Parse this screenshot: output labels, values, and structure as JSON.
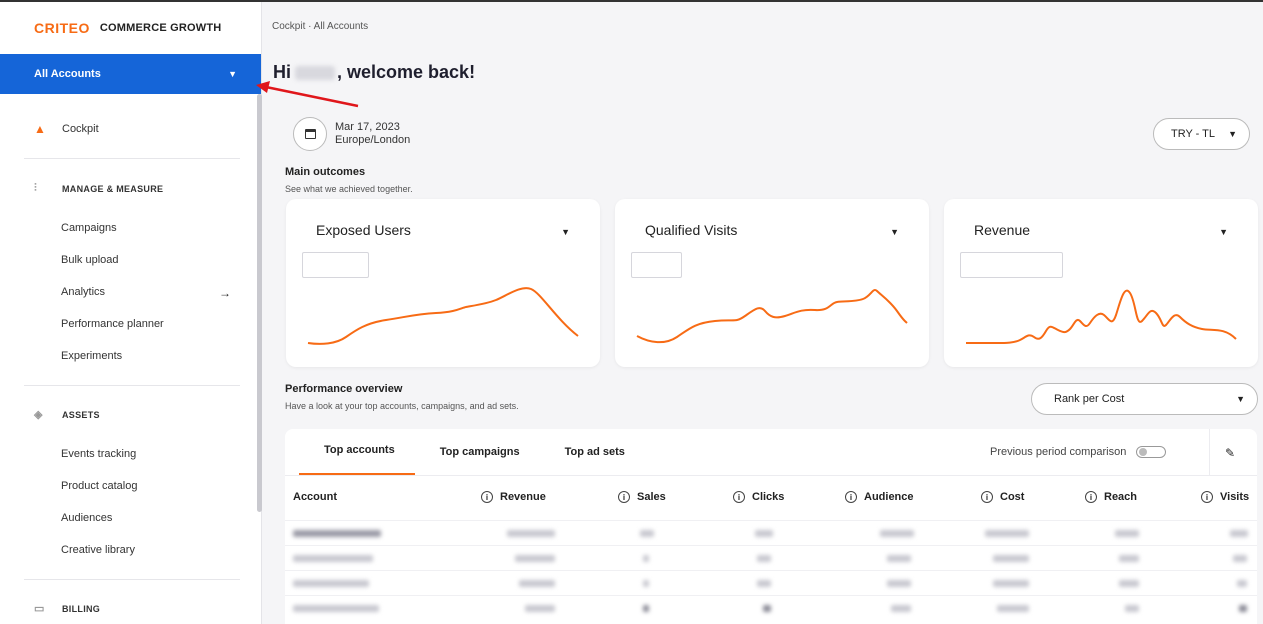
{
  "brand": {
    "logo": "CRITEO",
    "name": "COMMERCE GROWTH"
  },
  "account_selector": {
    "label": "All Accounts"
  },
  "sidebar": {
    "cockpit": "Cockpit",
    "sections": [
      {
        "title": "MANAGE & MEASURE",
        "items": [
          "Campaigns",
          "Bulk upload",
          "Analytics",
          "Performance planner",
          "Experiments"
        ]
      },
      {
        "title": "ASSETS",
        "items": [
          "Events tracking",
          "Product catalog",
          "Audiences",
          "Creative library"
        ]
      },
      {
        "title": "BILLING",
        "items": []
      }
    ]
  },
  "breadcrumb": "Cockpit · All Accounts",
  "welcome": {
    "prefix": "Hi",
    "suffix": ", welcome back!"
  },
  "date": {
    "date": "Mar 17, 2023",
    "timezone": "Europe/London"
  },
  "currency": "TRY - TL",
  "main_outcomes": {
    "title": "Main outcomes",
    "subtitle": "See what we achieved together.",
    "cards": [
      {
        "title": "Exposed Users"
      },
      {
        "title": "Qualified Visits"
      },
      {
        "title": "Revenue"
      }
    ]
  },
  "performance": {
    "title": "Performance overview",
    "subtitle": "Have a look at your top accounts, campaigns, and ad sets.",
    "rank": "Rank per Cost",
    "tabs": [
      "Top accounts",
      "Top campaigns",
      "Top ad sets"
    ],
    "active_tab": 0,
    "comparison_label": "Previous period comparison",
    "comparison_enabled": false,
    "columns": [
      "Account",
      "Revenue",
      "Sales",
      "Clicks",
      "Audience",
      "Cost",
      "Reach",
      "Visits"
    ]
  },
  "colors": {
    "accent": "#f76b15",
    "primary": "#1565d8",
    "annotation": "#e0161b"
  }
}
